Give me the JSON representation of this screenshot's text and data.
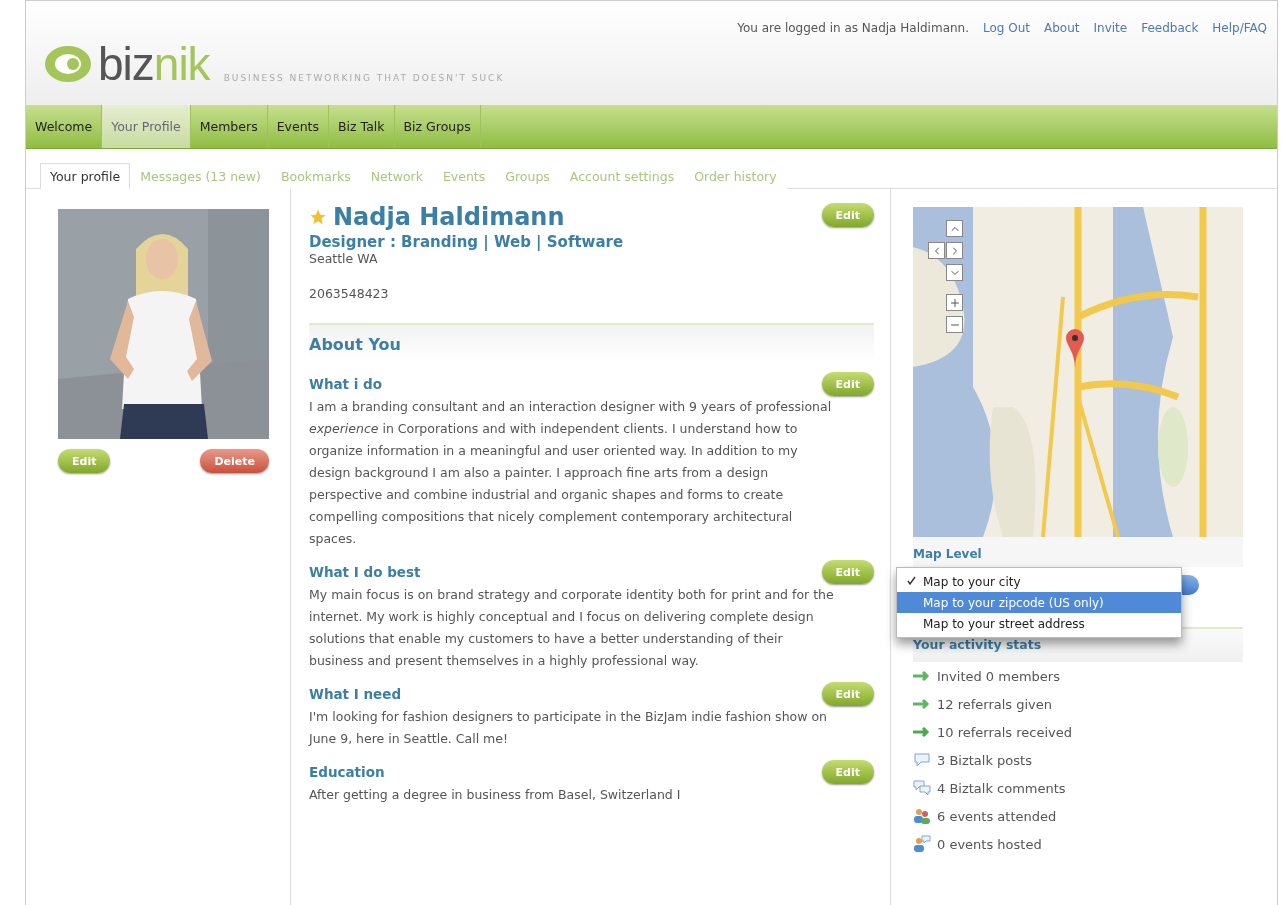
{
  "header": {
    "logo": {
      "dark": "biz",
      "light": "nik"
    },
    "tagline": "BUSINESS NETWORKING THAT DOESN'T SUCK",
    "login_text": "You are logged in as Nadja Haldimann.",
    "links": [
      "Log Out",
      "About",
      "Invite",
      "Feedback",
      "Help/FAQ"
    ]
  },
  "nav": [
    {
      "label": "Welcome",
      "selected": false
    },
    {
      "label": "Your Profile",
      "selected": true
    },
    {
      "label": "Members",
      "selected": false
    },
    {
      "label": "Events",
      "selected": false
    },
    {
      "label": "Biz Talk",
      "selected": false
    },
    {
      "label": "Biz Groups",
      "selected": false
    }
  ],
  "subtabs": [
    {
      "label": "Your profile",
      "selected": true
    },
    {
      "label": "Messages (13 new)",
      "selected": false
    },
    {
      "label": "Bookmarks",
      "selected": false
    },
    {
      "label": "Network",
      "selected": false
    },
    {
      "label": "Events",
      "selected": false
    },
    {
      "label": "Groups",
      "selected": false
    },
    {
      "label": "Account settings",
      "selected": false
    },
    {
      "label": "Order history",
      "selected": false
    }
  ],
  "photo": {
    "buttons": [
      {
        "label": "Edit",
        "kind": "edit"
      },
      {
        "label": "Delete",
        "kind": "delete"
      }
    ]
  },
  "profile": {
    "name": "Nadja Haldimann",
    "starred": true,
    "title": "Designer : Branding | Web | Software",
    "location": "Seattle WA",
    "phone": "2063548423",
    "edit": "Edit"
  },
  "about": {
    "heading": "About You",
    "sections": [
      {
        "title": "What i do",
        "edit": "Edit",
        "text": "I am a branding consultant and an interaction designer with 9 years of professional *experience* in Corporations and with independent clients. I understand how to organize information in a meaningful and user oriented way. In addition to my design background I am also a painter. I approach fine arts from a design perspective and combine industrial and organic shapes and forms to create compelling compositions that nicely complement contemporary architectural spaces."
      },
      {
        "title": "What I do best",
        "edit": "Edit",
        "text": "My main focus is on brand strategy and corporate identity both for print and for the internet. My work is highly conceptual and I focus on delivering complete design solutions that enable my customers to have a better understanding of their business and present themselves in a highly professional way."
      },
      {
        "title": "What I need",
        "edit": "Edit",
        "text": "I'm looking for fashion designers to participate in the BizJam indie fashion show on June 9, here in Seattle. Call me!"
      },
      {
        "title": "Education",
        "edit": "Edit",
        "text": "After getting a degree in business from Basel, Switzerland I"
      }
    ]
  },
  "map": {
    "level_label": "Map Level",
    "options": [
      {
        "label": "Map to your city",
        "checked": true,
        "selected": false
      },
      {
        "label": "Map to your zipcode (US only)",
        "checked": false,
        "selected": true
      },
      {
        "label": "Map to your street address",
        "checked": false,
        "selected": false
      }
    ]
  },
  "stats": {
    "heading": "Your activity stats",
    "items": [
      {
        "kind": "invite",
        "text": "Invited 0 members"
      },
      {
        "kind": "invite",
        "text": "12 referrals given"
      },
      {
        "kind": "received",
        "text": "10 referrals received"
      },
      {
        "kind": "post",
        "text": "3 Biztalk posts"
      },
      {
        "kind": "comment",
        "text": "4 Biztalk comments"
      },
      {
        "kind": "attended",
        "text": "6 events attended"
      },
      {
        "kind": "hosted",
        "text": "0 events hosted"
      }
    ]
  }
}
